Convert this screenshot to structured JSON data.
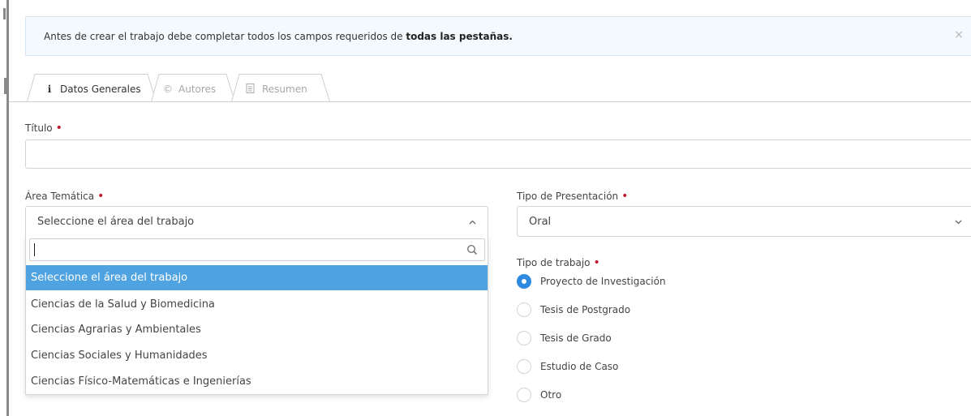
{
  "alert": {
    "text_prefix": "Antes de crear el trabajo debe completar todos los campos requeridos de ",
    "text_bold": "todas las pestañas.",
    "close_glyph": "×"
  },
  "tabs": [
    {
      "label": "Datos Generales",
      "icon": "info-icon",
      "glyph": "i",
      "active": true
    },
    {
      "label": "Autores",
      "icon": "copyright-icon",
      "glyph": "©",
      "active": false
    },
    {
      "label": "Resumen",
      "icon": "document-icon",
      "glyph": "",
      "active": false
    }
  ],
  "form": {
    "titulo_label": "Título",
    "titulo_value": "",
    "area_label": "Área Temática",
    "area_value": "Seleccione el área del trabajo",
    "tipo_presentacion_label": "Tipo de Presentación",
    "tipo_presentacion_value": "Oral",
    "tipo_trabajo_label": "Tipo de trabajo",
    "required_mark": "•"
  },
  "dropdown": {
    "search_value": "",
    "options": [
      {
        "label": "Seleccione el área del trabajo",
        "selected": true
      },
      {
        "label": "Ciencias de la Salud y Biomedicina",
        "selected": false
      },
      {
        "label": "Ciencias Agrarias y Ambientales",
        "selected": false
      },
      {
        "label": "Ciencias Sociales y Humanidades",
        "selected": false
      },
      {
        "label": "Ciencias Físico-Matemáticas e Ingenierías",
        "selected": false
      }
    ]
  },
  "tipo_trabajo_options": [
    {
      "label": "Proyecto de Investigación",
      "checked": true
    },
    {
      "label": "Tesis de Postgrado",
      "checked": false
    },
    {
      "label": "Tesis de Grado",
      "checked": false
    },
    {
      "label": "Estudio de Caso",
      "checked": false
    },
    {
      "label": "Otro",
      "checked": false
    }
  ],
  "colors": {
    "accent": "#2d8ae0",
    "selected_option": "#4fa3e0",
    "required": "#c0182e",
    "alert_bg": "#f4f9fd"
  }
}
